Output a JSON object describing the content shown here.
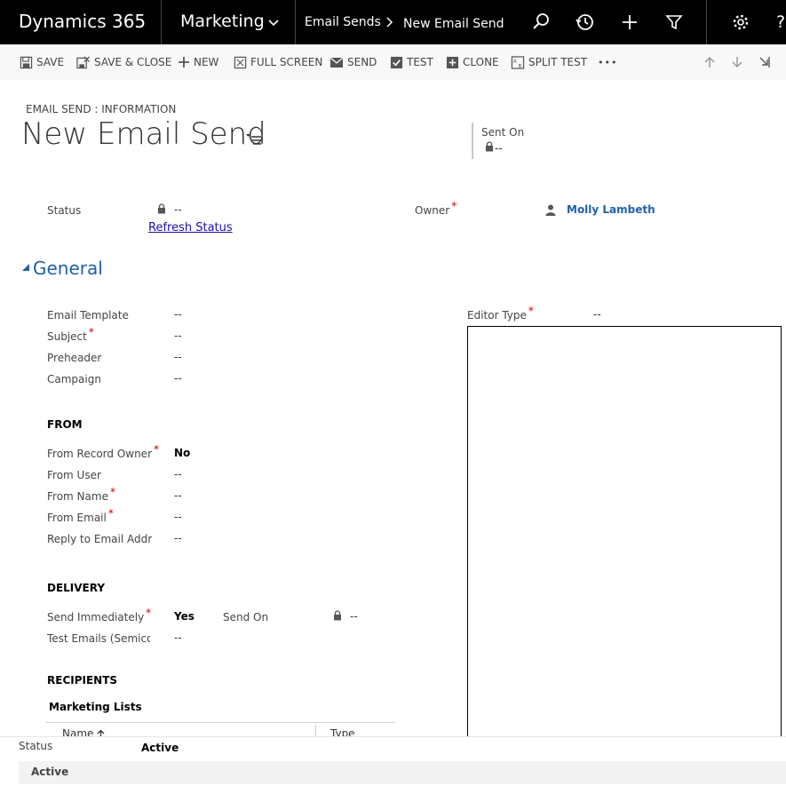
{
  "nav": {
    "brand": "Dynamics 365",
    "module": "Marketing",
    "breadcrumb_1": "Email Sends",
    "breadcrumb_2": "New Email Send",
    "help_glyph": "?"
  },
  "commands": {
    "save": "SAVE",
    "save_close": "SAVE & CLOSE",
    "new": "NEW",
    "full_screen": "FULL SCREEN",
    "send": "SEND",
    "test": "TEST",
    "clone": "CLONE",
    "split_test": "SPLIT TEST",
    "more": "•••"
  },
  "header": {
    "entity_label": "EMAIL SEND : INFORMATION",
    "title": "New Email Send",
    "sent_on_label": "Sent On",
    "sent_on_value": "--"
  },
  "summary": {
    "status_label": "Status",
    "status_value": "--",
    "refresh_link": "Refresh Status",
    "owner_label": "Owner",
    "owner_value": "Molly Lambeth"
  },
  "general": {
    "section_title": "General",
    "email_template_label": "Email Template",
    "email_template_value": "--",
    "subject_label": "Subject",
    "subject_value": "--",
    "preheader_label": "Preheader",
    "preheader_value": "--",
    "campaign_label": "Campaign",
    "campaign_value": "--",
    "editor_type_label": "Editor Type",
    "editor_type_value": "--"
  },
  "from": {
    "heading": "FROM",
    "record_owner_label": "From Record Owner",
    "record_owner_value": "No",
    "user_label": "From User",
    "user_value": "--",
    "name_label": "From Name",
    "name_value": "--",
    "email_label": "From Email",
    "email_value": "--",
    "reply_label": "Reply to Email Addres",
    "reply_value": "--"
  },
  "delivery": {
    "heading": "DELIVERY",
    "send_immediately_label": "Send Immediately",
    "send_immediately_value": "Yes",
    "send_on_label": "Send On",
    "send_on_value": "--",
    "test_emails_label": "Test Emails (Semicolon",
    "test_emails_value": "--"
  },
  "recipients": {
    "heading": "RECIPIENTS",
    "subgrid_title": "Marketing Lists",
    "col_name": "Name",
    "col_type": "Type"
  },
  "footer": {
    "status_label": "Status",
    "status_value": "Active",
    "bar_text": "Active"
  },
  "colors": {
    "accent_blue": "#2160a8",
    "required_red": "#c00000",
    "nav_bg": "#000000"
  }
}
